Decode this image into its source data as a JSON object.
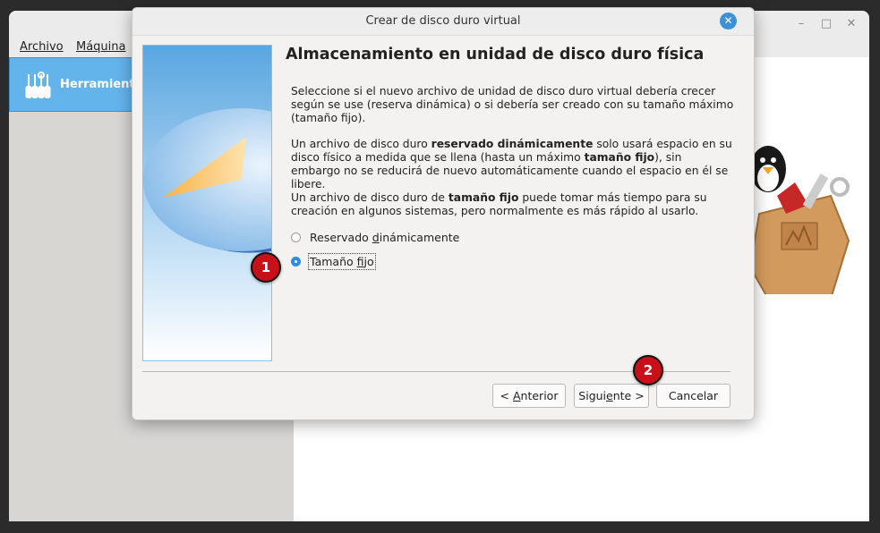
{
  "main_window": {
    "menu": [
      "Archivo",
      "Máquina"
    ],
    "tools_label": "Herramientas",
    "controls": {
      "minimize": "–",
      "maximize": "□",
      "close": "✕"
    }
  },
  "dialog": {
    "title": "Crear de disco duro virtual",
    "close_glyph": "✕",
    "heading": "Almacenamiento en unidad de disco duro física",
    "para1": "Seleccione si el nuevo archivo de unidad de disco duro virtual debería crecer según se use (reserva dinámica) o si debería ser creado con su tamaño máximo (tamaño fijo).",
    "para2": {
      "a": "Un archivo de disco duro ",
      "b": "reservado dinámicamente",
      "c": " solo usará espacio en su disco físico a medida que se llena (hasta un máximo ",
      "d": "tamaño fijo",
      "e": "), sin embargo no se reducirá de nuevo automáticamente cuando el espacio en él se libere."
    },
    "para3": {
      "a": "Un archivo de disco duro de ",
      "b": "tamaño fijo",
      "c": " puede tomar más tiempo para su creación en algunos sistemas, pero normalmente es más rápido al usarlo."
    },
    "options": [
      {
        "label_pre": "Reservado ",
        "label_u": "d",
        "label_post": "inámicamente",
        "checked": false
      },
      {
        "label_pre": "Tamaño ",
        "label_u": "f",
        "label_post": "ijo",
        "checked": true
      }
    ],
    "buttons": {
      "back": {
        "pre": "< ",
        "u": "A",
        "post": "nterior"
      },
      "next": {
        "pre": "Sigui",
        "u": "e",
        "post": "nte >"
      },
      "cancel": "Cancelar"
    }
  },
  "markers": [
    "1",
    "2"
  ],
  "colors": {
    "accent": "#2f8ae0",
    "selection": "#64b4ec",
    "marker": "#c8101a"
  }
}
